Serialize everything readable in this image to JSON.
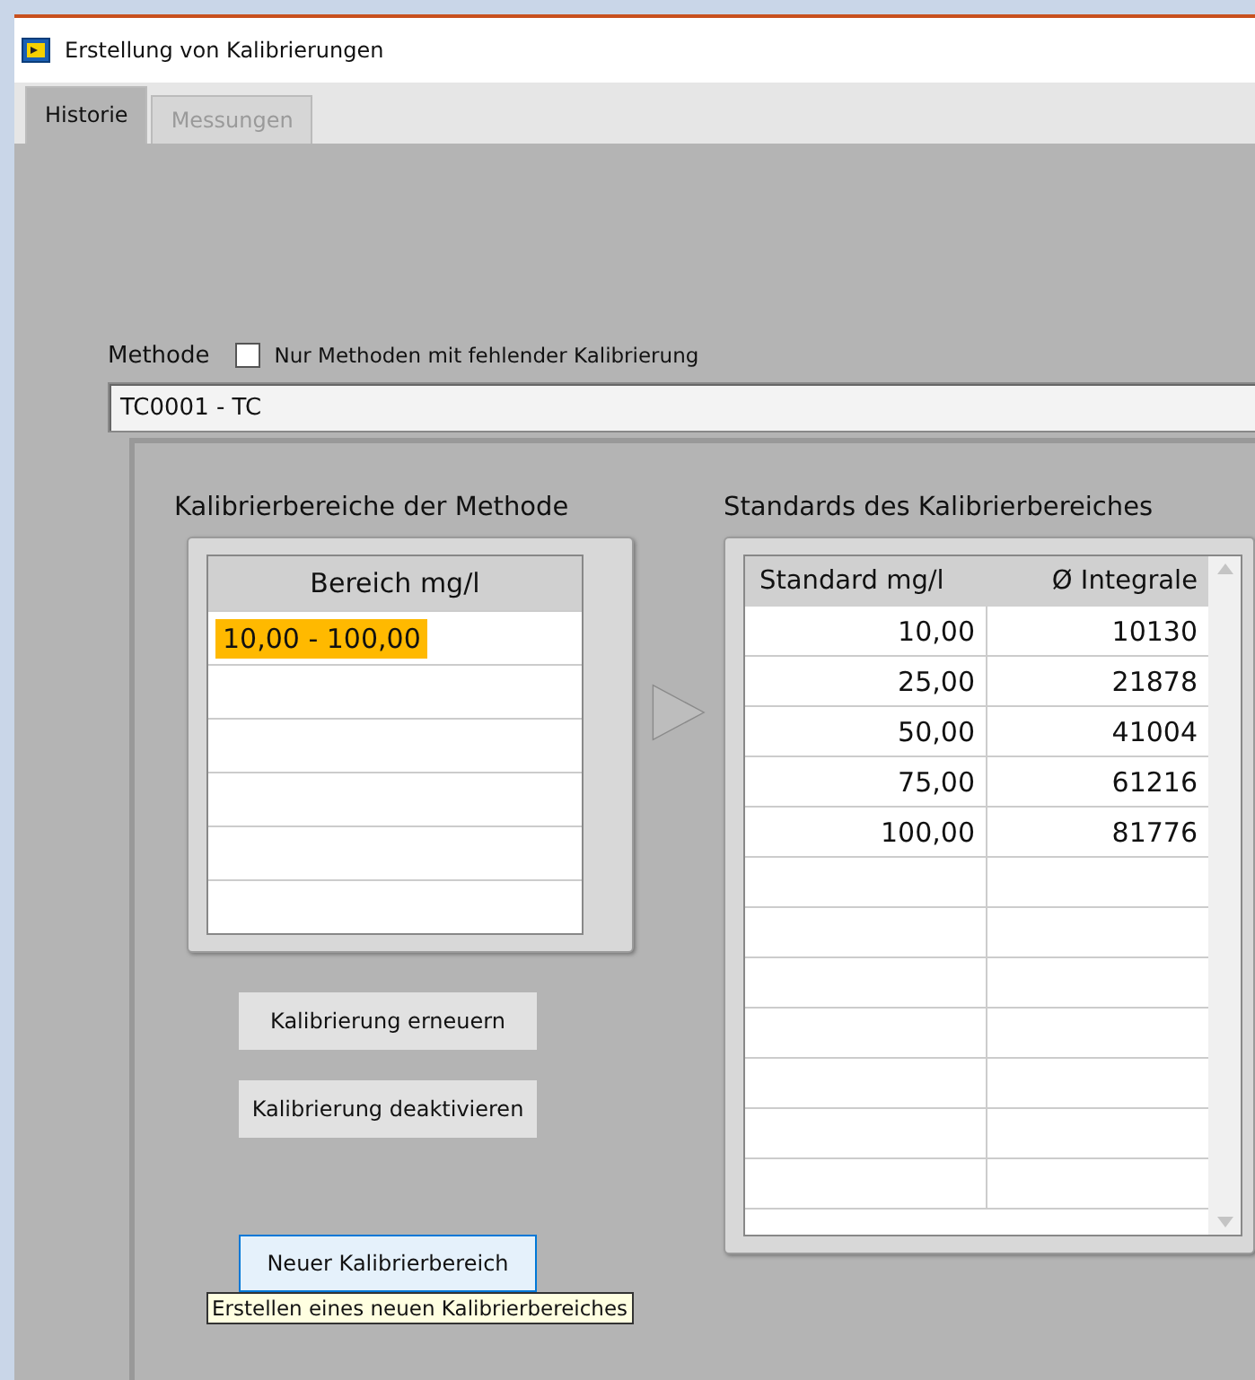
{
  "window": {
    "title": "Erstellung von Kalibrierungen"
  },
  "tabs": [
    {
      "label": "Historie",
      "selected": true
    },
    {
      "label": "Messungen",
      "selected": false
    }
  ],
  "method": {
    "label": "Methode",
    "filter": {
      "label": "Nur Methoden mit fehlender Kalibrierung",
      "checked": false
    },
    "value": "TC0001 - TC"
  },
  "ranges": {
    "title": "Kalibrierbereiche der Methode",
    "column": "Bereich mg/l",
    "rows": [
      {
        "value": "10,00 - 100,00",
        "selected": true
      }
    ]
  },
  "standards": {
    "title": "Standards des Kalibrierbereiches",
    "columns": [
      "Standard mg/l",
      "Ø Integrale"
    ],
    "rows": [
      {
        "standard": "10,00",
        "integral": "10130"
      },
      {
        "standard": "25,00",
        "integral": "21878"
      },
      {
        "standard": "50,00",
        "integral": "41004"
      },
      {
        "standard": "75,00",
        "integral": "61216"
      },
      {
        "standard": "100,00",
        "integral": "81776"
      }
    ]
  },
  "buttons": [
    {
      "label": "Kalibrierung erneuern",
      "focused": false
    },
    {
      "label": "Kalibrierung deaktivieren",
      "focused": false
    },
    {
      "label": "Neuer Kalibrierbereich",
      "focused": true
    }
  ],
  "tooltip": "Erstellen eines neuen Kalibrierbereiches"
}
